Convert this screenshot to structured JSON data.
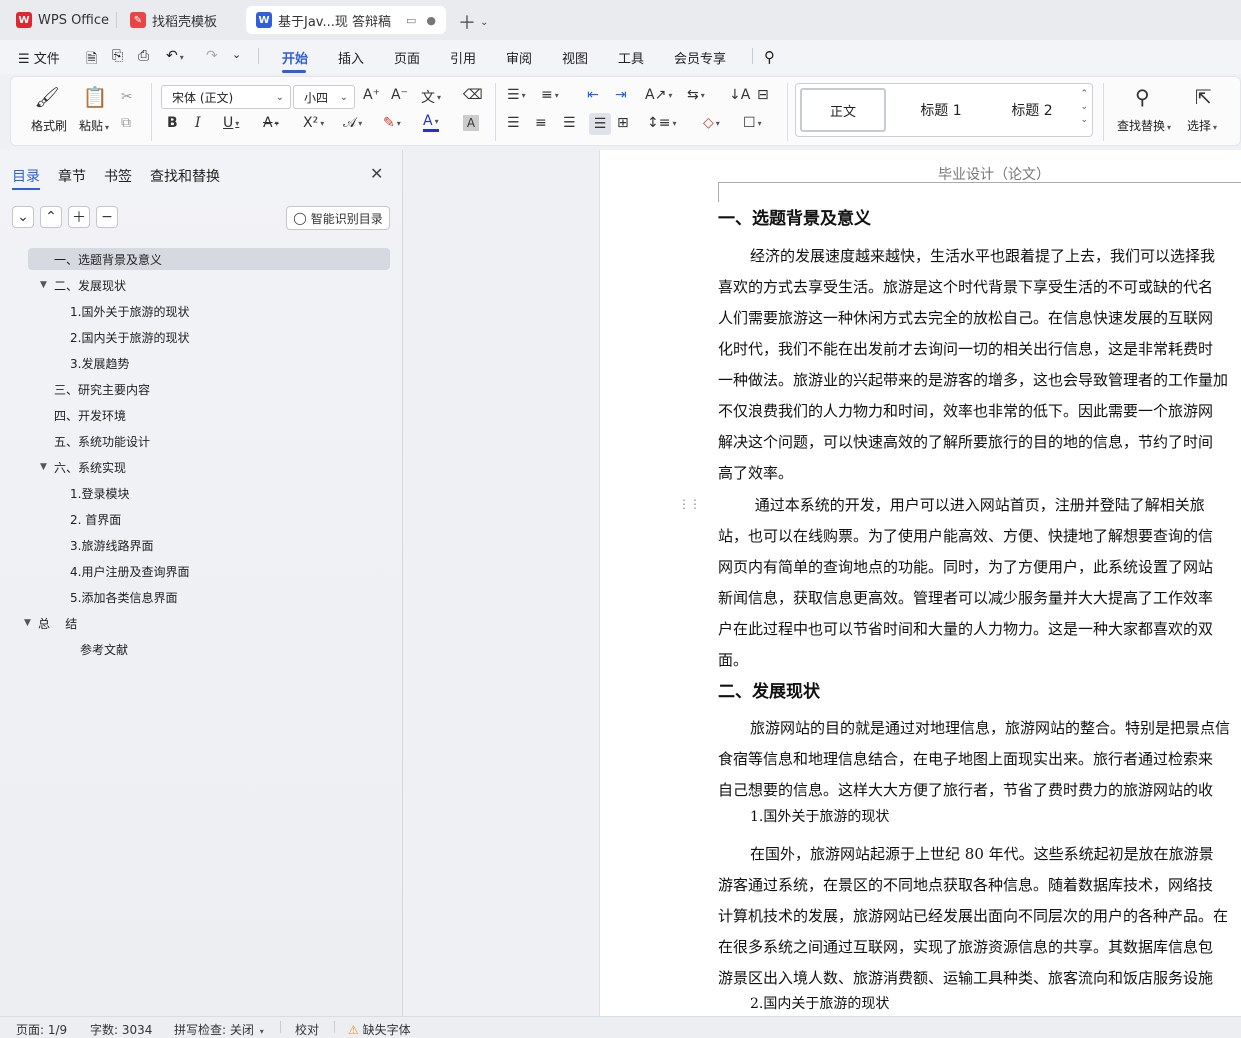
{
  "tabs": [
    {
      "label": "WPS Office",
      "icon": "wps-logo-icon"
    },
    {
      "label": "找稻壳模板",
      "icon": "daoke-logo-icon"
    },
    {
      "label": "基于Jav...现 答辩稿",
      "icon": "word-doc-icon"
    }
  ],
  "menu": {
    "file": "文件",
    "items": [
      "开始",
      "插入",
      "页面",
      "引用",
      "审阅",
      "视图",
      "工具",
      "会员专享"
    ],
    "active": "开始"
  },
  "ribbon": {
    "format_painter": "格式刷",
    "paste": "粘贴",
    "font_name": "宋体 (正文)",
    "font_size": "小四",
    "styles": [
      "正文",
      "标题 1",
      "标题 2"
    ],
    "find_replace": "查找替换",
    "select": "选择"
  },
  "sidebar": {
    "tabs": [
      "目录",
      "章节",
      "书签",
      "查找和替换"
    ],
    "smart_toc": "智能识别目录",
    "toc": [
      {
        "label": "一、选题背景及意义",
        "level": 0,
        "selected": true
      },
      {
        "label": "二、发展现状",
        "level": 0,
        "expanded": true
      },
      {
        "label": "1.国外关于旅游的现状",
        "level": 1
      },
      {
        "label": "2.国内关于旅游的现状",
        "level": 1
      },
      {
        "label": "3.发展趋势",
        "level": 1
      },
      {
        "label": "三、研究主要内容",
        "level": 0
      },
      {
        "label": "四、开发环境",
        "level": 0
      },
      {
        "label": "五、系统功能设计",
        "level": 0
      },
      {
        "label": "六、系统实现",
        "level": 0,
        "expanded": true
      },
      {
        "label": "1.登录模块",
        "level": 1
      },
      {
        "label": "2. 首界面",
        "level": 1
      },
      {
        "label": "3.旅游线路界面",
        "level": 1
      },
      {
        "label": "4.用户注册及查询界面",
        "level": 1
      },
      {
        "label": "5.添加各类信息界面",
        "level": 1
      },
      {
        "label": "总    结",
        "level": -1,
        "expanded": true
      },
      {
        "label": "参考文献",
        "level": 2
      }
    ]
  },
  "document": {
    "header": "毕业设计（论文）",
    "lines": [
      {
        "text": "一、选题背景及意义",
        "kind": "h1"
      },
      {
        "text": "经济的发展速度越来越快，生活水平也跟着提了上去，我们可以选择我",
        "kind": "ind"
      },
      {
        "text": "喜欢的方式去享受生活。旅游是这个时代背景下享受生活的不可或缺的代名",
        "kind": "p"
      },
      {
        "text": "人们需要旅游这一种休闲方式去完全的放松自己。在信息快速发展的互联网",
        "kind": "p"
      },
      {
        "text": "化时代，我们不能在出发前才去询问一切的相关出行信息，这是非常耗费时",
        "kind": "p"
      },
      {
        "text": "一种做法。旅游业的兴起带来的是游客的增多，这也会导致管理者的工作量加",
        "kind": "p"
      },
      {
        "text": "不仅浪费我们的人力物力和时间，效率也非常的低下。因此需要一个旅游网",
        "kind": "p"
      },
      {
        "text": "解决这个问题，可以快速高效的了解所要旅行的目的地的信息，节约了时间",
        "kind": "p"
      },
      {
        "text": "高了效率。",
        "kind": "p"
      },
      {
        "text": " 通过本系统的开发，用户可以进入网站首页，注册并登陆了解相关旅",
        "kind": "ind"
      },
      {
        "text": "站，也可以在线购票。为了使用户能高效、方便、快捷地了解想要查询的信",
        "kind": "p"
      },
      {
        "text": "网页内有简单的查询地点的功能。同时，为了方便用户，此系统设置了网站",
        "kind": "p"
      },
      {
        "text": "新闻信息，获取信息更高效。管理者可以减少服务量并大大提高了工作效率",
        "kind": "p"
      },
      {
        "text": "户在此过程中也可以节省时间和大量的人力物力。这是一种大家都喜欢的双",
        "kind": "p"
      },
      {
        "text": "面。",
        "kind": "p"
      },
      {
        "text": "二、发展现状",
        "kind": "h1"
      },
      {
        "text": "旅游网站的目的就是通过对地理信息，旅游网站的整合。特别是把景点信",
        "kind": "ind"
      },
      {
        "text": "食宿等信息和地理信息结合，在电子地图上面现实出来。旅行者通过检索来",
        "kind": "p"
      },
      {
        "text": "自己想要的信息。这样大大方便了旅行者，节省了费时费力的旅游网站的收",
        "kind": "p"
      },
      {
        "text": "1.国外关于旅游的现状",
        "kind": "ind"
      },
      {
        "text": "在国外，旅游网站起源于上世纪 80 年代。这些系统起初是放在旅游景",
        "kind": "ind"
      },
      {
        "text": "游客通过系统，在景区的不同地点获取各种信息。随着数据库技术，网络技",
        "kind": "p"
      },
      {
        "text": "计算机技术的发展，旅游网站已经发展出面向不同层次的用户的各种产品。在",
        "kind": "p"
      },
      {
        "text": "在很多系统之间通过互联网，实现了旅游资源信息的共享。其数据库信息包",
        "kind": "p"
      },
      {
        "text": "游景区出入境人数、旅游消费额、运输工具种类、旅客流向和饭店服务设施",
        "kind": "p"
      },
      {
        "text": "2.国内关于旅游的现状",
        "kind": "ind"
      }
    ]
  },
  "status": {
    "page": "页面: 1/9",
    "words": "字数: 3034",
    "spell": "拼写检查: 关闭",
    "proof": "校对",
    "missing_font": "缺失字体"
  }
}
